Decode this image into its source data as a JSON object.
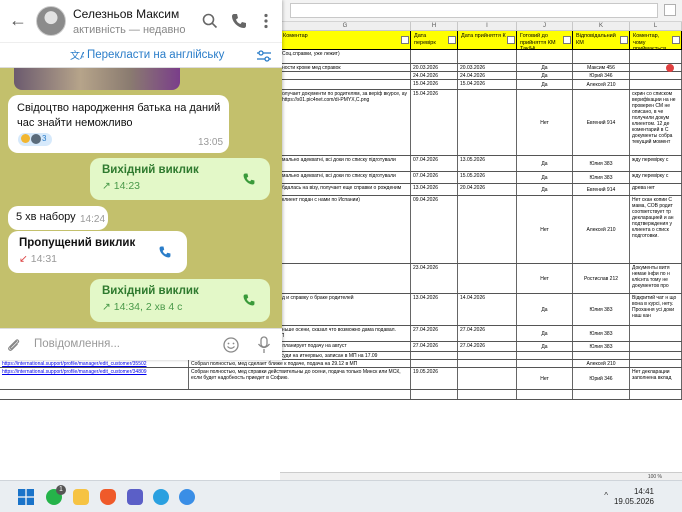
{
  "spreadsheet": {
    "column_letters": [
      "G",
      "H",
      "I",
      "J",
      "K",
      "L"
    ],
    "headers": {
      "comment": "Коментар",
      "check_date": "Дата перевірк",
      "accepted_date": "Дата прийняття К",
      "ready_tm": "Готовий до прийняття КМ Так/Ні",
      "responsible": "Відповідальний КМ",
      "note": "Коментар, чому приймається КМ"
    },
    "status_zoom": "100 %",
    "rows": [
      {
        "com": "Соц.справки, уже лежит)",
        "h": "",
        "i": "",
        "j": "",
        "k": "",
        "l": ""
      },
      {
        "com": "ности кроме мед справок",
        "h": "20.03.2026",
        "i": "20.03.2026",
        "j": "Да",
        "k": "Максим 456",
        "l": ""
      },
      {
        "com": "",
        "h": "24.04.2026",
        "i": "24.04.2026",
        "j": "Да",
        "k": "Юрий 346",
        "l": ""
      },
      {
        "com": "",
        "h": "15.04.2026",
        "i": "15.04.2026",
        "j": "Да",
        "k": "Алексей 210",
        "l": ""
      },
      {
        "com": "олучает документи по родителям, за верiф вкурсе, ay https://s01.pic4net.com/di-PMYX,C.png",
        "h": "15.04.2026",
        "i": "",
        "j": "Нет",
        "k": "Евгений 914",
        "l": "скрин со списком верифікации на не проверен СМ не описано, в че получили докум клиентом. 12 де коментарий в С документы собра текущий момент"
      },
      {
        "com": "мально адекватні, всі доки по списку підготували",
        "h": "07.04.2026",
        "i": "13.05.2026",
        "j": "Да",
        "k": "Юлия 383",
        "l": "жду перевірку с"
      },
      {
        "com": "мально адекватні, всі доки по списку підготували",
        "h": "07.04.2026",
        "i": "15.05.2026",
        "j": "Да",
        "k": "Юлия 383",
        "l": "жду перевірку с"
      },
      {
        "com": "бдалась на візу, получает еще справки о рожденим",
        "h": "13.04.2026",
        "i": "20.04.2026",
        "j": "Да",
        "k": "Евгений 914",
        "l": "древа нет"
      },
      {
        "com": "клиент подан с нами по Испании)",
        "h": "09.04.2026",
        "i": "",
        "j": "Нет",
        "k": "Алексей 210",
        "l": "Нет скан копии С мама, СОВ родит соответствует тр декларацией и ан подтверждения у клиента о списк подготовки."
      },
      {
        "com": "",
        "h": "23.04.2026",
        "i": "",
        "j": "Нет",
        "k": "Ростислав 212",
        "l": "Документы витя немае інфи по н клієнта тому не документов про"
      },
      {
        "com": "д и справку о браке родителей",
        "h": "13.04.2026",
        "i": "14.04.2026",
        "j": "Да",
        "k": "Юлия 383",
        "l": "Відкритий чат н що вона в курсі, нету. Прохання усі доки наш кан"
      },
      {
        "link": "https://international.support/profile/manager/edit_customer/36002",
        "com": "О верификации знает, планирует не раньше осени, сказал что возможно дама подавал. Супруга сегодня подана лично он по ВП",
        "h": "27.04.2026",
        "i": "27.04.2026",
        "j": "Да",
        "k": "Юлия 383",
        "l": ""
      },
      {
        "link": "https://international.support/profile/manager/edit_customer/39111",
        "com": "все доскe наш канал, оформляет визу, планирует подачу на август",
        "h": "27.04.2026",
        "i": "27.04.2026",
        "j": "Да",
        "k": "Юлия 383",
        "l": ""
      },
      {
        "link": "https://international.support/profile/manager/edit_customer/34763",
        "com": "Полностью собран, обновит МЕД и Несуди на итнервью, записан в МП на 17.09",
        "h": "",
        "i": "",
        "j": "",
        "k": "",
        "l": ""
      },
      {
        "link": "https://international.support/profile/manager/edit_customer/35502",
        "com": "Собрал полностью, мед сделает ближе к подаче, подача на 29.12 в МП",
        "h": "",
        "i": "",
        "j": "",
        "k": "Алексей 210",
        "l": ""
      },
      {
        "link": "https://international.support/profile/manager/edit_customer/34809",
        "com": "Собран полностью, мед справки действительны до осени, подача только Минск или МСК, если будет надобность приедет в Софию.",
        "h": "19.05.2026",
        "i": "",
        "j": "Нет",
        "k": "Юрий 346",
        "l": "Нет декларации заполнена вклад"
      },
      {
        "com": "",
        "h": "",
        "i": "",
        "j": "",
        "k": "",
        "l": ""
      }
    ]
  },
  "telegram": {
    "contact_name": "Селезньов Максим",
    "contact_status": "активність — недавно",
    "translate_label": "Перекласти на англійську",
    "messages": {
      "m1_text": "Свідоцтво народження батька на даний час знайти неможливо",
      "m1_time": "13:05",
      "m1_reaction_count": "3",
      "c1_title": "Вихідний виклик",
      "c1_time": "14:23",
      "m2_text": "5 хв набору",
      "m2_time": "14:24",
      "c2_title": "Пропущений виклик",
      "c2_time": "14:31",
      "c3_title": "Вихідний виклик",
      "c3_time": "14:34, 2 хв 4 с"
    },
    "composer_placeholder": "Повідомлення..."
  },
  "taskbar": {
    "time": "14:41",
    "date": "19.05.2026",
    "whatsapp_badge": "1",
    "tray_arrow": "^",
    "apps": [
      "windows-start",
      "whatsapp",
      "file-explorer",
      "brave",
      "teams",
      "telegram",
      "chrome"
    ]
  },
  "colors": {
    "header_yellow": "#ffff00",
    "outgoing_bubble": "#e3f8c8",
    "accent_blue": "#2a7dc9",
    "missed_red": "#d44"
  }
}
